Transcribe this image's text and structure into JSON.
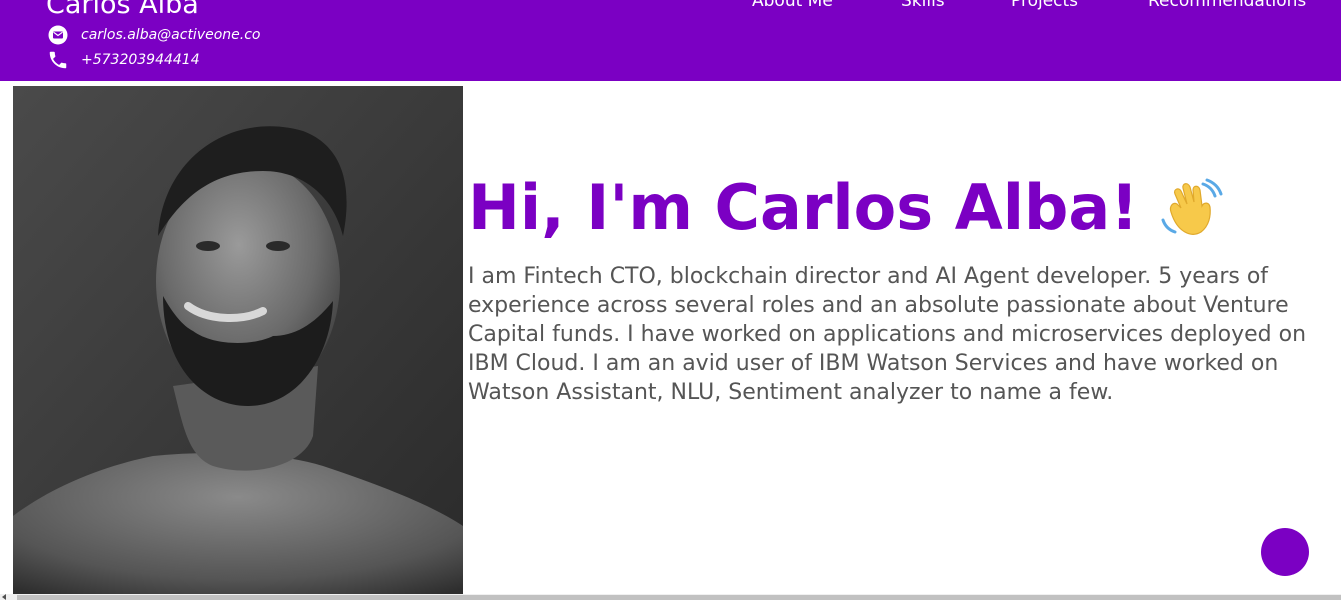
{
  "header": {
    "brand_name": "Carlos Alba",
    "email": "carlos.alba@activeone.co",
    "phone": "+573203944414",
    "email_icon": "email-icon",
    "phone_icon": "phone-icon",
    "background_color": "#7b00c3"
  },
  "nav": {
    "items": [
      {
        "label": "About Me"
      },
      {
        "label": "Skills"
      },
      {
        "label": "Projects"
      },
      {
        "label": "Recommendations"
      }
    ]
  },
  "hero": {
    "title": "Hi, I'm Carlos Alba!",
    "emoji_icon": "waving-hand-icon",
    "bio": "I am Fintech CTO, blockchain director and AI Agent developer. 5 years of experience across several roles and an absolute passionate about Venture Capital funds. I have worked on applications and microservices deployed on IBM Cloud. I am an avid user of IBM Watson Services and have worked on Watson Assistant, NLU, Sentiment analyzer to name a few.",
    "title_color": "#7b00c3",
    "bio_color": "#555555"
  },
  "profile": {
    "image": "profile-photo"
  },
  "fab": {
    "icon": "floating-action-button",
    "color": "#7b00c3"
  }
}
